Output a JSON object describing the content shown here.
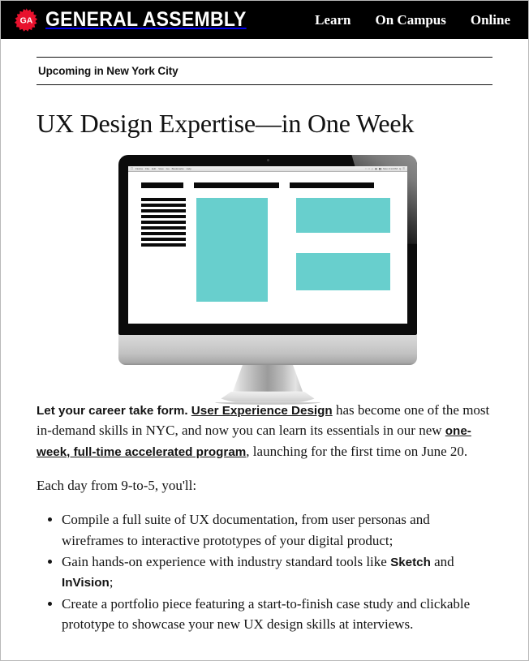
{
  "header": {
    "logo_badge_text": "GA",
    "brand_name": "GENERAL ASSEMBLY",
    "logo_color": "#e8112d",
    "background": "#000000",
    "nav": [
      {
        "label": "Learn"
      },
      {
        "label": "On Campus"
      },
      {
        "label": "Online"
      }
    ]
  },
  "article": {
    "eyebrow": "Upcoming in New York City",
    "title": "UX Design Expertise—in One Week",
    "figure": {
      "alt": "iMac displaying a wireframe layout mockup",
      "accent_color": "#68cfcd",
      "browser": {
        "apple_menu": "",
        "menus": [
          "Firefox",
          "File",
          "Edit",
          "View",
          "Go",
          "Bookmarks",
          "Help"
        ],
        "status_items": [
          "○",
          "□",
          "◇",
          "▣",
          "▮▮",
          "Mon 3:14 PM",
          "Q",
          "☰"
        ]
      },
      "wireframe": {
        "heading_bars": 3,
        "text_lines": 9,
        "teal_blocks": 3
      }
    },
    "intro_paragraph": {
      "lead_bold": "Let your career take form.",
      "link_1": "User Experience Design",
      "text_1": " has become one of the most in-demand skills in NYC, and now you can learn its essentials in our new ",
      "link_2": "one-week, full-time accelerated program",
      "text_2": ", launching for the first time on June 20."
    },
    "schedule_line": "Each day from 9-to-5, you'll:",
    "bullets": [
      {
        "parts": [
          {
            "type": "text",
            "value": "Compile a full suite of UX documentation, from user personas and wireframes to interactive prototypes of your digital product;"
          }
        ]
      },
      {
        "parts": [
          {
            "type": "text",
            "value": "Gain hands-on experience with industry standard tools like "
          },
          {
            "type": "bold",
            "value": "Sketch"
          },
          {
            "type": "text",
            "value": " and "
          },
          {
            "type": "bold",
            "value": "InVision"
          },
          {
            "type": "text",
            "value": ";"
          }
        ]
      },
      {
        "parts": [
          {
            "type": "text",
            "value": "Create a portfolio piece featuring a start-to-finish case study and clickable prototype to showcase your new UX design skills at interviews."
          }
        ]
      }
    ]
  }
}
